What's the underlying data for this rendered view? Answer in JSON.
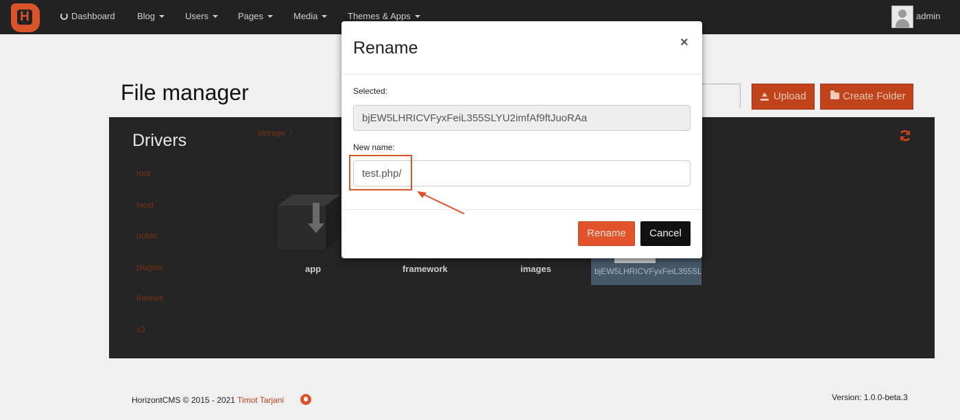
{
  "navbar": {
    "items": [
      {
        "label": "Dashboard",
        "has_caret": false
      },
      {
        "label": "Blog",
        "has_caret": true
      },
      {
        "label": "Users",
        "has_caret": true
      },
      {
        "label": "Pages",
        "has_caret": true
      },
      {
        "label": "Media",
        "has_caret": true
      },
      {
        "label": "Themes & Apps",
        "has_caret": true
      }
    ],
    "user": "admin"
  },
  "page": {
    "title": "File manager",
    "upload_label": "Upload",
    "create_folder_label": "Create Folder"
  },
  "drivers": {
    "title": "Drivers",
    "items": [
      "root",
      "local",
      "public",
      "plugins",
      "themes",
      "s3"
    ]
  },
  "breadcrumb": {
    "current": "storage",
    "separator": "/"
  },
  "files": [
    {
      "name": "app"
    },
    {
      "name": "framework"
    },
    {
      "name": "images"
    },
    {
      "name": "bjEW5LHRICVFyxFeiL355SLYU2imfAf9ftJuoRAa",
      "selected": true
    }
  ],
  "modal": {
    "title": "Rename",
    "close": "×",
    "selected_label": "Selected:",
    "selected_value": "bjEW5LHRICVFyxFeiL355SLYU2imfAf9ftJuoRAa",
    "new_name_label": "New name:",
    "new_name_value": "test.php/",
    "rename_button": "Rename",
    "cancel_button": "Cancel"
  },
  "footer": {
    "copyright": "HorizontCMS © 2015 - 2021",
    "author": "Timot Tarjani",
    "version": "Version: 1.0.0-beta.3"
  },
  "colors": {
    "accent": "#d9542b",
    "navbar": "#222222",
    "panel": "#242424",
    "highlight": "#d9542b"
  }
}
